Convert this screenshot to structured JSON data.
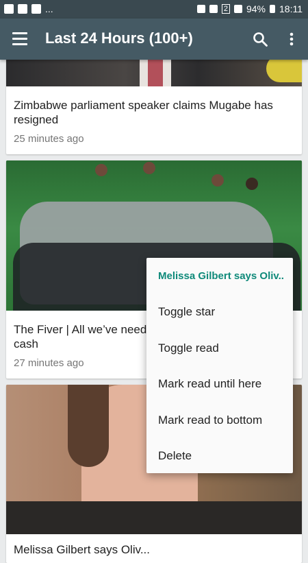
{
  "status": {
    "battery": "94%",
    "time": "18:11",
    "sim": "2",
    "notif_more": "..."
  },
  "appbar": {
    "title": "Last 24 Hours (100+)"
  },
  "articles": [
    {
      "title": "Zimbabwe parliament speaker claims Mugabe has resigned",
      "time": "25 minutes ago"
    },
    {
      "title": "The Fiver | All we’ve needed, bundles of television cash",
      "time": "27 minutes ago"
    },
    {
      "title": "Melissa Gilbert says Oliv..."
    }
  ],
  "context_menu": {
    "header": "Melissa Gilbert says Oliv..",
    "items": [
      "Toggle star",
      "Toggle read",
      "Mark read until here",
      "Mark read to bottom",
      "Delete"
    ]
  },
  "colors": {
    "status_bar": "#3a4950",
    "app_bar": "#455a64",
    "accent": "#0f8a7a",
    "background": "#e9ebec"
  },
  "icons": [
    "menu-icon",
    "search-icon",
    "more-vertical-icon"
  ]
}
